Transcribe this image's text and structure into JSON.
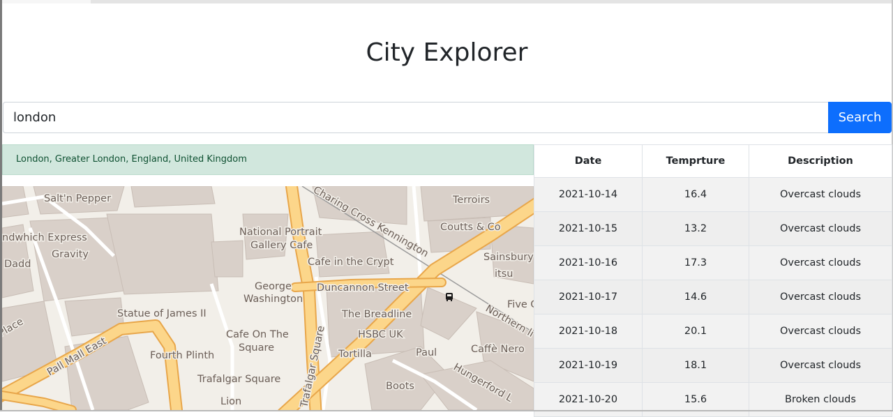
{
  "page": {
    "title": "City Explorer"
  },
  "search": {
    "value": "london",
    "button_label": "Search"
  },
  "location": {
    "display_name": "London, Greater London, England, United Kingdom"
  },
  "map": {
    "labels": [
      "Salt'n Pepper",
      "Charing Cross  Kennington",
      "Terroirs",
      "Coutts & Co",
      "National Portrait",
      "Gallery Cafe",
      "ndwhich Express",
      "Gravity",
      "Dadd",
      "Cafe in the Crypt",
      "Sainsbury'",
      "itsu",
      "George",
      "Washington",
      "Duncannon Street",
      "Five G",
      "Statue of James II",
      "The Breadline",
      "Northern li",
      "Place",
      "HSBC UK",
      "Cafe On The",
      "Square",
      "Caffè Nero",
      "Pall Mall East",
      "Fourth Plinth",
      "Tortilla",
      "Paul",
      "Trafalgar Square",
      "Trafalgar Square",
      "Hungerford L",
      "Boots",
      "Lion"
    ],
    "bus_stop_icon": "bus-icon"
  },
  "weather_table": {
    "columns": [
      "Date",
      "Temprture",
      "Description"
    ],
    "rows": [
      {
        "date": "2021-10-14",
        "temp": "16.4",
        "description": "Overcast clouds"
      },
      {
        "date": "2021-10-15",
        "temp": "13.2",
        "description": "Overcast clouds"
      },
      {
        "date": "2021-10-16",
        "temp": "17.3",
        "description": "Overcast clouds"
      },
      {
        "date": "2021-10-17",
        "temp": "14.6",
        "description": "Overcast clouds"
      },
      {
        "date": "2021-10-18",
        "temp": "20.1",
        "description": "Overcast clouds"
      },
      {
        "date": "2021-10-19",
        "temp": "18.1",
        "description": "Overcast clouds"
      },
      {
        "date": "2021-10-20",
        "temp": "15.6",
        "description": "Broken clouds"
      }
    ]
  },
  "colors": {
    "primary": "#0d6efd",
    "alert_bg": "#d1e7dd",
    "alert_text": "#0f5132",
    "map_land": "#f2efe9",
    "map_building": "#d9d0c9",
    "map_major_road": "#fcd68a",
    "map_major_road_casing": "#e8a64a"
  }
}
